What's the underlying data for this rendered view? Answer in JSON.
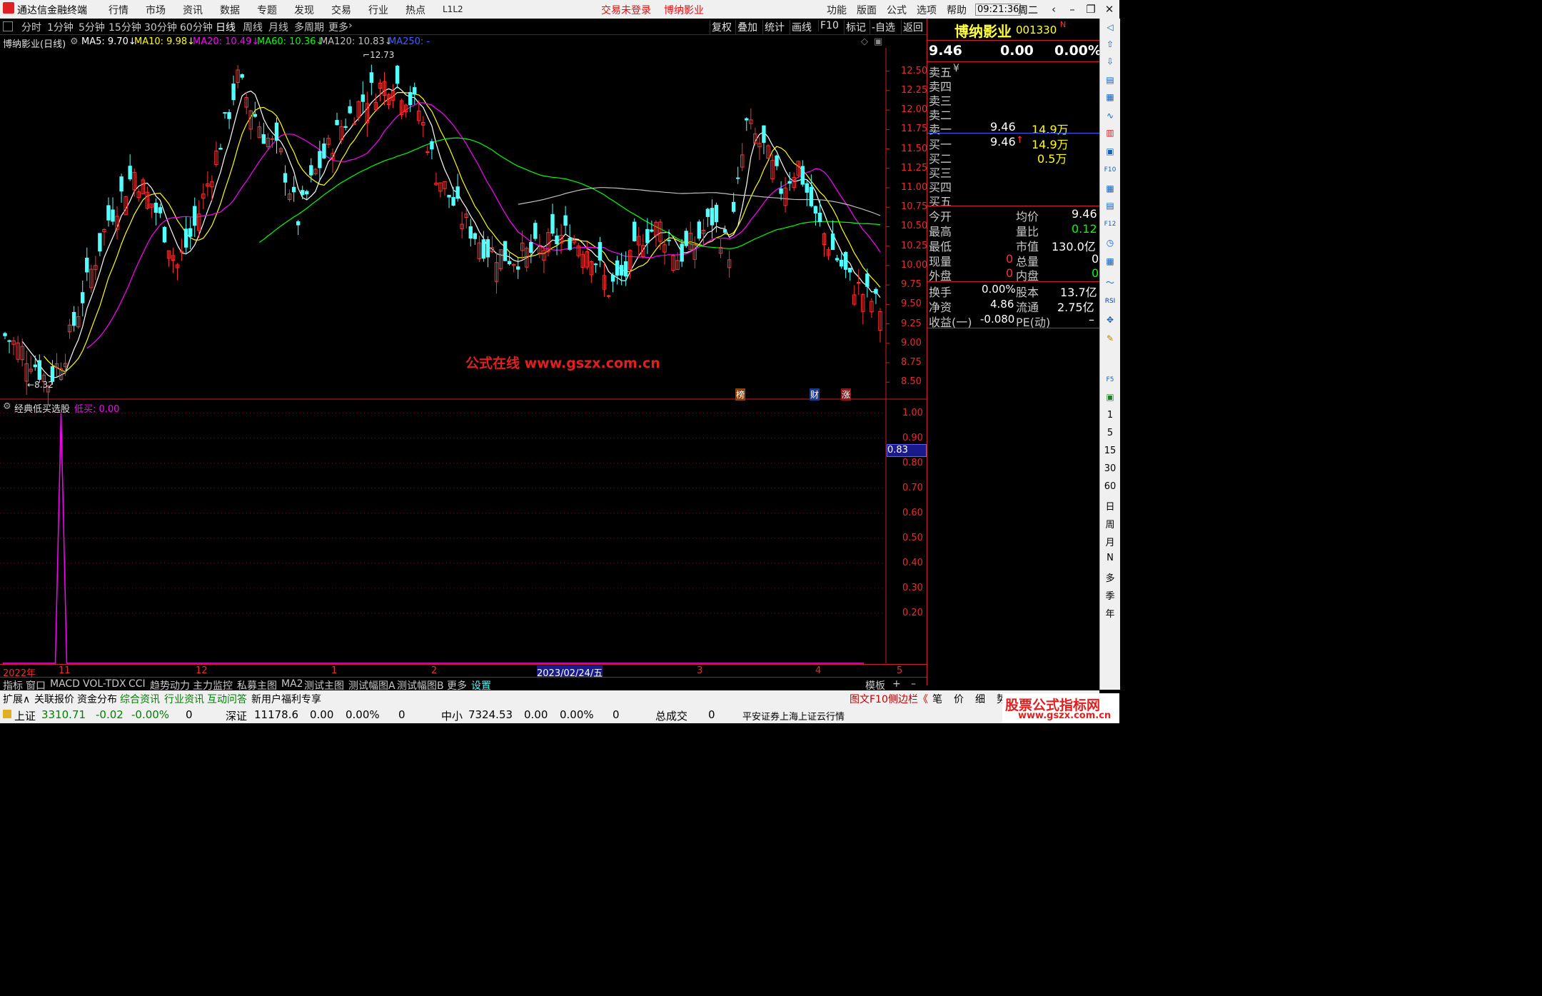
{
  "titlebar": {
    "app_name": "通达信金融终端",
    "menu": [
      "行情",
      "市场",
      "资讯",
      "数据",
      "专题",
      "发现",
      "交易",
      "行业",
      "热点",
      "L1L2"
    ],
    "login_status": "交易未登录",
    "stock_name": "博纳影业",
    "right_menu": [
      "功能",
      "版面",
      "公式",
      "选项",
      "帮助"
    ],
    "time": "09:21:36",
    "weekday": "周二"
  },
  "toolbar": {
    "periods": [
      "分时",
      "1分钟",
      "5分钟",
      "15分钟",
      "30分钟",
      "60分钟",
      "日线",
      "周线",
      "月线",
      "多周期",
      "更多"
    ],
    "active_period": "日线",
    "right_buttons": [
      "复权",
      "叠加",
      "统计",
      "画线",
      "F10",
      "标记",
      "-自选",
      "返回"
    ]
  },
  "ma_legend": {
    "title": "博纳影业(日线)",
    "items": [
      {
        "label": "MA5: 9.70",
        "arrow": "↓",
        "color": "#ffffff"
      },
      {
        "label": "MA10: 9.98",
        "arrow": "↓",
        "color": "#ffff00"
      },
      {
        "label": "MA20: 10.49",
        "arrow": "↓",
        "color": "#ff00ff"
      },
      {
        "label": "MA60: 10.36",
        "arrow": "↓",
        "color": "#00ff00"
      },
      {
        "label": "MA120: 10.83",
        "arrow": "↓",
        "color": "#c0c0c0"
      },
      {
        "label": "MA250: -",
        "arrow": "",
        "color": "#4040ff"
      }
    ]
  },
  "main_chart": {
    "y_ticks": [
      "12.50",
      "12.25",
      "12.00",
      "11.75",
      "11.50",
      "11.25",
      "11.00",
      "10.75",
      "10.50",
      "10.25",
      "10.00",
      "9.75",
      "9.50",
      "9.25",
      "9.00",
      "8.75",
      "8.50"
    ],
    "high_label": "12.73",
    "low_label": "8.32",
    "watermark": "公式在线 www.gszx.com.cn",
    "event_markers": [
      "榜",
      "财",
      "涨"
    ]
  },
  "indicator": {
    "name": "经典低买选股",
    "series_label": "低买: 0.00",
    "y_ticks": [
      "1.00",
      "0.90",
      "0.80",
      "0.70",
      "0.60",
      "0.50",
      "0.40",
      "0.30",
      "0.20"
    ],
    "cursor_value": "0.83"
  },
  "date_axis": {
    "labels": [
      "2022年",
      "11",
      "12",
      "1",
      "2",
      "2023/02/24/五",
      "3",
      "4",
      "5"
    ],
    "period_label": "日线"
  },
  "chart_data": {
    "type": "candlestick",
    "title": "博纳影业(日线)",
    "ylim": [
      8.3,
      12.8
    ],
    "high": 12.73,
    "low": 8.32,
    "ma": {
      "MA5": 9.7,
      "MA10": 9.98,
      "MA20": 10.49,
      "MA60": 10.36,
      "MA120": 10.83
    },
    "indicator_spike": 1.0
  },
  "quote_panel": {
    "name": "博纳影业",
    "code": "001330",
    "badge": "N",
    "price": "9.46",
    "change": "0.00",
    "change_pct": "0.00%",
    "asks": [
      {
        "label": "卖五",
        "extra": "¥",
        "price": "",
        "vol": ""
      },
      {
        "label": "卖四",
        "extra": "",
        "price": "",
        "vol": ""
      },
      {
        "label": "卖三",
        "extra": "",
        "price": "",
        "vol": ""
      },
      {
        "label": "卖二",
        "extra": "",
        "price": "",
        "vol": ""
      },
      {
        "label": "卖一",
        "extra": "",
        "price": "9.46",
        "vol": "14.9万"
      }
    ],
    "bids": [
      {
        "label": "买一",
        "price": "9.46",
        "arrow": "↑",
        "vol": "14.9万"
      },
      {
        "label": "买二",
        "price": "",
        "arrow": "",
        "vol": "0.5万"
      },
      {
        "label": "买三",
        "price": "",
        "arrow": "",
        "vol": ""
      },
      {
        "label": "买四",
        "price": "",
        "arrow": "",
        "vol": ""
      },
      {
        "label": "买五",
        "price": "",
        "arrow": "",
        "vol": ""
      }
    ],
    "stats1": [
      {
        "l1": "今开",
        "v1": "",
        "l2": "均价",
        "v2": "9.46",
        "c2": "wv"
      },
      {
        "l1": "最高",
        "v1": "",
        "l2": "量比",
        "v2": "0.12",
        "c2": "gv"
      },
      {
        "l1": "最低",
        "v1": "",
        "l2": "市值",
        "v2": "130.0亿",
        "c2": "wv"
      },
      {
        "l1": "现量",
        "v1": "0",
        "l2": "总量",
        "v2": "0",
        "c2": "wv"
      },
      {
        "l1": "外盘",
        "v1": "0",
        "l2": "内盘",
        "v2": "0",
        "c2": "gv"
      }
    ],
    "stats2": [
      {
        "l1": "换手",
        "v1": "0.00%",
        "l2": "股本",
        "v2": "13.7亿"
      },
      {
        "l1": "净资",
        "v1": "4.86",
        "l2": "流通",
        "v2": "2.75亿"
      },
      {
        "l1": "收益(一)",
        "v1": "-0.080",
        "l2": "PE(动)",
        "v2": "–"
      }
    ]
  },
  "side_icons": [
    "1",
    "5",
    "15",
    "30",
    "60",
    "日",
    "周",
    "月",
    "N",
    "多",
    "季",
    "年"
  ],
  "bottom_tabs": {
    "row1": [
      "指标",
      "窗口",
      "MACD",
      "VOL-TDX",
      "CCI",
      "趋势动力",
      "主力监控",
      "私募主图",
      "MA2",
      "测试主图",
      "测试幅图A",
      "测试幅图B",
      "更多",
      "设置"
    ],
    "row1_right": [
      "模板",
      "+",
      "–"
    ],
    "row2": [
      "扩展∧",
      "关联报价",
      "资金分布",
      "综合资讯",
      "行业资讯",
      "互动问答",
      "新用户福利专享"
    ],
    "row2_right": [
      "图文F10",
      "侧边栏《",
      "笔",
      "价",
      "细",
      "势"
    ]
  },
  "status_bar": {
    "indices": [
      {
        "name": "上证",
        "value": "3310.71",
        "chg": "-0.02",
        "pct": "-0.00%",
        "vol": "0"
      },
      {
        "name": "深证",
        "value": "11178.6",
        "chg": "0.00",
        "pct": "0.00%",
        "vol": "0"
      },
      {
        "name": "中小",
        "value": "7324.53",
        "chg": "0.00",
        "pct": "0.00%",
        "vol": "0"
      }
    ],
    "total_label": "总成交",
    "total_value": "0",
    "broker": "平安证券上海上证云行情",
    "corner_logo": "股票公式指标网",
    "corner_url": "www.gszx.com.cn"
  }
}
